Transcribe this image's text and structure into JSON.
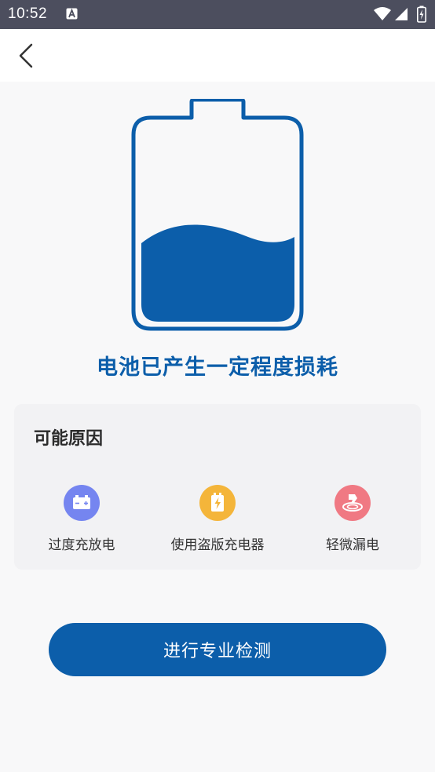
{
  "status_bar": {
    "time": "10:52",
    "background": "#4c4e5e",
    "icons": [
      "text-a-icon",
      "wifi-icon",
      "cellular-signal-icon",
      "battery-charging-icon"
    ]
  },
  "app_bar": {
    "back_icon": "chevron-left-icon"
  },
  "battery": {
    "icon": "battery-level-graphic",
    "color": "#0c5eaa"
  },
  "headline": "电池已产生一定程度损耗",
  "reasons": {
    "title": "可能原因",
    "items": [
      {
        "label": "过度充放电",
        "icon": "battery-plus-minus-icon",
        "color": "#7585f0"
      },
      {
        "label": "使用盗版充电器",
        "icon": "charger-bolt-icon",
        "color": "#f4b53a"
      },
      {
        "label": "轻微漏电",
        "icon": "leak-icon",
        "color": "#f07983"
      }
    ]
  },
  "action": {
    "label": "进行专业检测",
    "color": "#0c5eaa"
  }
}
